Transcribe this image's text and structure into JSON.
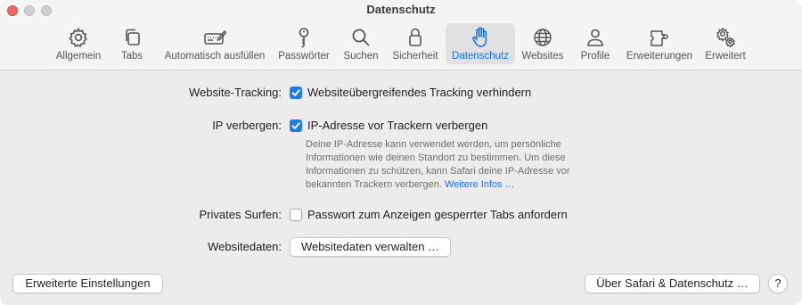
{
  "window": {
    "title": "Datenschutz"
  },
  "toolbar": {
    "tabs": [
      {
        "label": "Allgemein",
        "icon": "gear-icon"
      },
      {
        "label": "Tabs",
        "icon": "tabs-icon"
      },
      {
        "label": "Automatisch ausfüllen",
        "icon": "autofill-icon"
      },
      {
        "label": "Passwörter",
        "icon": "key-icon"
      },
      {
        "label": "Suchen",
        "icon": "magnifier-icon"
      },
      {
        "label": "Sicherheit",
        "icon": "lock-icon"
      },
      {
        "label": "Datenschutz",
        "icon": "hand-icon",
        "active": true
      },
      {
        "label": "Websites",
        "icon": "globe-icon"
      },
      {
        "label": "Profile",
        "icon": "person-icon"
      },
      {
        "label": "Erweiterungen",
        "icon": "puzzle-icon"
      },
      {
        "label": "Erweitert",
        "icon": "gears-icon"
      }
    ]
  },
  "settings": {
    "tracking": {
      "label": "Website-Tracking:",
      "option": "Websiteübergreifendes Tracking verhindern",
      "checked": true
    },
    "ip": {
      "label": "IP verbergen:",
      "option": "IP-Adresse vor Trackern verbergen",
      "checked": true,
      "description_lines": [
        "Deine IP-Adresse kann verwendet werden, um persönliche",
        "Informationen wie deinen Standort zu bestimmen. Um diese",
        "Informationen zu schützen, kann Safari deine IP-Adresse vor",
        "bekannten Trackern verbergen."
      ],
      "more_link": "Weitere Infos …"
    },
    "private": {
      "label": "Privates Surfen:",
      "option": "Passwort zum Anzeigen gesperrter Tabs anfordern",
      "checked": false
    },
    "website_data": {
      "label": "Websitedaten:",
      "button": "Websitedaten verwalten …"
    }
  },
  "footer": {
    "advanced_button": "Erweiterte Einstellungen",
    "about_button": "Über Safari & Datenschutz …",
    "help_button": "?"
  },
  "colors": {
    "accent": "#1470e0",
    "checkbox_on": "#1f7aed",
    "close": "#ec6a5e"
  }
}
